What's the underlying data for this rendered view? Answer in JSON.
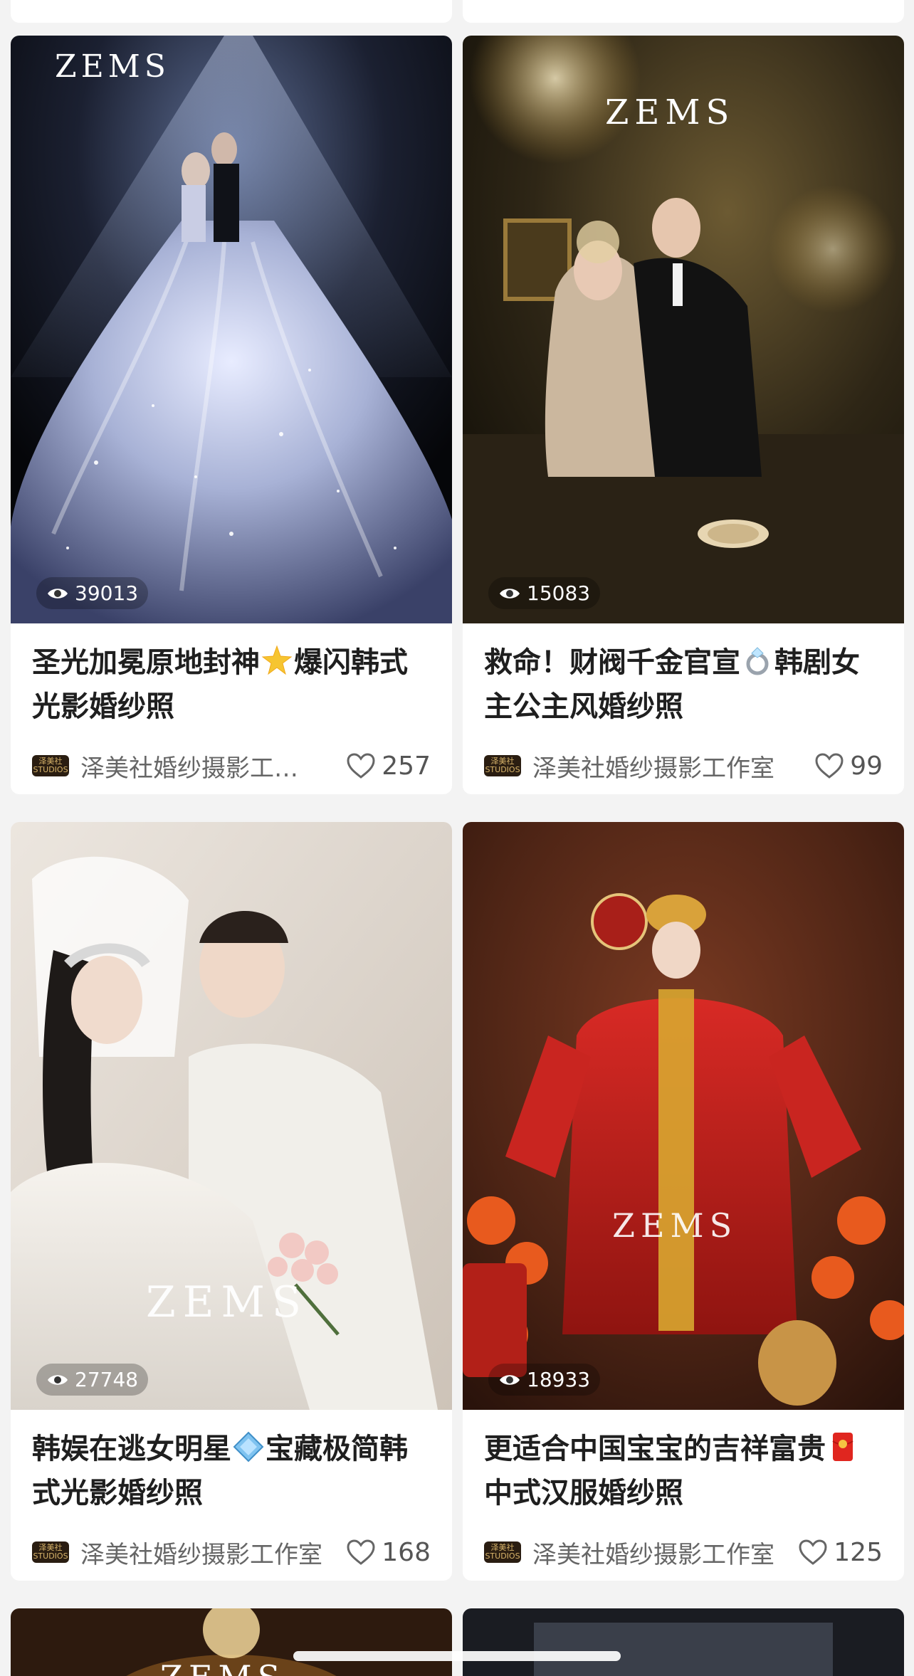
{
  "cards": [
    {
      "views": "39013",
      "title_part1": "圣光加冕原地封神",
      "emoji": "star-icon",
      "title_part2": "爆闪韩式光影婚纱照",
      "author": "泽美社婚纱摄影工…",
      "likes": "257",
      "watermark": "ZEMS"
    },
    {
      "views": "15083",
      "title_part1": "救命！财阀千金官宣",
      "emoji": "ring-icon",
      "title_part2": "韩剧女主公主风婚纱照",
      "author": "泽美社婚纱摄影工作室",
      "likes": "99",
      "watermark": "ZEMS"
    },
    {
      "views": "27748",
      "title_part1": "韩娱在逃女明星",
      "emoji": "diamond-icon",
      "title_part2": "宝藏极简韩式光影婚纱照",
      "author": "泽美社婚纱摄影工作室",
      "likes": "168",
      "watermark": "ZEMS"
    },
    {
      "views": "18933",
      "title_part1": "更适合中国宝宝的吉祥富贵",
      "emoji": "red-envelope-icon",
      "title_part2": "中式汉服婚纱照",
      "author": "泽美社婚纱摄影工作室",
      "likes": "125",
      "watermark": "ZEMS"
    }
  ],
  "author_logo_text": "泽美社 STUDIOS",
  "partial_bottom_watermark": "ZEMS",
  "colors": {
    "background": "#f3f3f3",
    "card": "#ffffff",
    "title": "#1f1f1f",
    "meta": "#666666"
  }
}
